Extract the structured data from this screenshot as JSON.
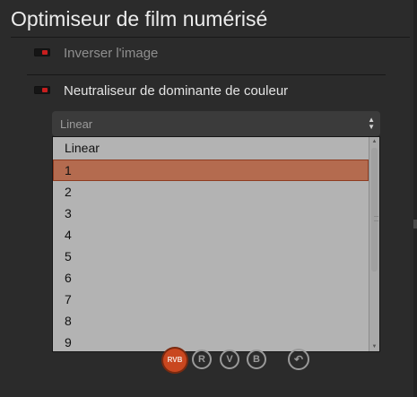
{
  "panel": {
    "title": "Optimiseur de film numérisé"
  },
  "options": [
    {
      "label": "Inverser l'image",
      "enabled": false
    },
    {
      "label": "Neutraliseur de dominante de couleur",
      "enabled": true
    }
  ],
  "select": {
    "value": "Linear",
    "options": [
      "Linear",
      "1",
      "2",
      "3",
      "4",
      "5",
      "6",
      "7",
      "8",
      "9"
    ],
    "highlighted": "1"
  },
  "channels": {
    "rvb": "RVB",
    "r": "R",
    "v": "V",
    "b": "B",
    "undo_icon": "undo-icon"
  },
  "colors": {
    "accent": "#c9471f",
    "selection": "#b46b4f",
    "toggle_led": "#c81e1e"
  }
}
